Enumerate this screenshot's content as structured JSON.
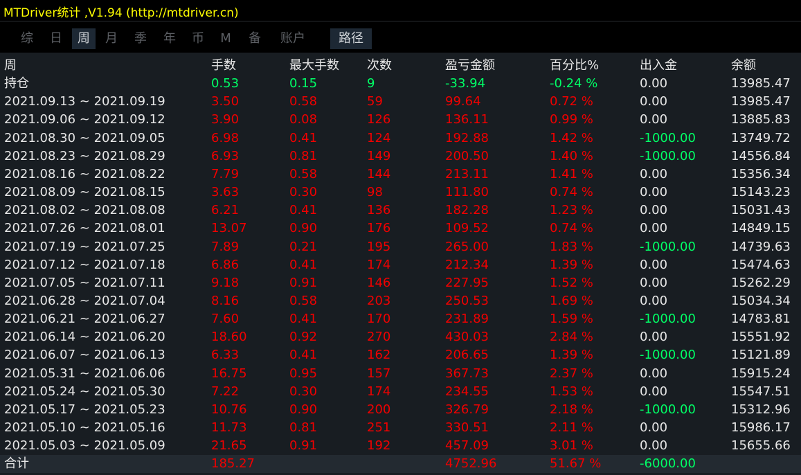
{
  "window": {
    "title": "MTDriver统计 ,V1.94 (http://mtdriver.cn)"
  },
  "colors": {
    "title": "#ffff00",
    "background": "#181d22",
    "text": "#e6e6e6",
    "loss": "#00ff66",
    "profit": "#f00000",
    "tab_inactive": "#5c5f64",
    "tab_active_bg": "#1d2834"
  },
  "tabs": [
    {
      "label": "综",
      "active": false
    },
    {
      "label": "日",
      "active": false
    },
    {
      "label": "周",
      "active": true
    },
    {
      "label": "月",
      "active": false
    },
    {
      "label": "季",
      "active": false
    },
    {
      "label": "年",
      "active": false
    },
    {
      "label": "币",
      "active": false
    },
    {
      "label": "M",
      "active": false
    },
    {
      "label": "备",
      "active": false
    },
    {
      "label": "账户",
      "active": false
    },
    {
      "label": "路径",
      "active": true
    }
  ],
  "columns": [
    "周",
    "手数",
    "最大手数",
    "次数",
    "盈亏金额",
    "百分比%",
    "出入金",
    "余额"
  ],
  "position_row": {
    "label": "持仓",
    "lots": "0.53",
    "max_lots": "0.15",
    "count": "9",
    "pnl": "-33.94",
    "pct": "-0.24 %",
    "flow": "0.00",
    "balance": "13985.47"
  },
  "rows": [
    {
      "week": "2021.09.13 ~ 2021.09.19",
      "lots": "3.50",
      "max_lots": "0.58",
      "count": "59",
      "pnl": "99.64",
      "pct": "0.72 %",
      "flow": "0.00",
      "balance": "13985.47"
    },
    {
      "week": "2021.09.06 ~ 2021.09.12",
      "lots": "3.90",
      "max_lots": "0.08",
      "count": "126",
      "pnl": "136.11",
      "pct": "0.99 %",
      "flow": "0.00",
      "balance": "13885.83"
    },
    {
      "week": "2021.08.30 ~ 2021.09.05",
      "lots": "6.98",
      "max_lots": "0.41",
      "count": "124",
      "pnl": "192.88",
      "pct": "1.42 %",
      "flow": "-1000.00",
      "balance": "13749.72"
    },
    {
      "week": "2021.08.23 ~ 2021.08.29",
      "lots": "6.93",
      "max_lots": "0.81",
      "count": "149",
      "pnl": "200.50",
      "pct": "1.40 %",
      "flow": "-1000.00",
      "balance": "14556.84"
    },
    {
      "week": "2021.08.16 ~ 2021.08.22",
      "lots": "7.79",
      "max_lots": "0.58",
      "count": "144",
      "pnl": "213.11",
      "pct": "1.41 %",
      "flow": "0.00",
      "balance": "15356.34"
    },
    {
      "week": "2021.08.09 ~ 2021.08.15",
      "lots": "3.63",
      "max_lots": "0.30",
      "count": "98",
      "pnl": "111.80",
      "pct": "0.74 %",
      "flow": "0.00",
      "balance": "15143.23"
    },
    {
      "week": "2021.08.02 ~ 2021.08.08",
      "lots": "6.21",
      "max_lots": "0.41",
      "count": "136",
      "pnl": "182.28",
      "pct": "1.23 %",
      "flow": "0.00",
      "balance": "15031.43"
    },
    {
      "week": "2021.07.26 ~ 2021.08.01",
      "lots": "13.07",
      "max_lots": "0.90",
      "count": "176",
      "pnl": "109.52",
      "pct": "0.74 %",
      "flow": "0.00",
      "balance": "14849.15"
    },
    {
      "week": "2021.07.19 ~ 2021.07.25",
      "lots": "7.89",
      "max_lots": "0.21",
      "count": "195",
      "pnl": "265.00",
      "pct": "1.83 %",
      "flow": "-1000.00",
      "balance": "14739.63"
    },
    {
      "week": "2021.07.12 ~ 2021.07.18",
      "lots": "6.86",
      "max_lots": "0.41",
      "count": "174",
      "pnl": "212.34",
      "pct": "1.39 %",
      "flow": "0.00",
      "balance": "15474.63"
    },
    {
      "week": "2021.07.05 ~ 2021.07.11",
      "lots": "9.18",
      "max_lots": "0.91",
      "count": "146",
      "pnl": "227.95",
      "pct": "1.52 %",
      "flow": "0.00",
      "balance": "15262.29"
    },
    {
      "week": "2021.06.28 ~ 2021.07.04",
      "lots": "8.16",
      "max_lots": "0.58",
      "count": "203",
      "pnl": "250.53",
      "pct": "1.69 %",
      "flow": "0.00",
      "balance": "15034.34"
    },
    {
      "week": "2021.06.21 ~ 2021.06.27",
      "lots": "7.60",
      "max_lots": "0.41",
      "count": "170",
      "pnl": "231.89",
      "pct": "1.59 %",
      "flow": "-1000.00",
      "balance": "14783.81"
    },
    {
      "week": "2021.06.14 ~ 2021.06.20",
      "lots": "18.60",
      "max_lots": "0.92",
      "count": "270",
      "pnl": "430.03",
      "pct": "2.84 %",
      "flow": "0.00",
      "balance": "15551.92"
    },
    {
      "week": "2021.06.07 ~ 2021.06.13",
      "lots": "6.33",
      "max_lots": "0.41",
      "count": "162",
      "pnl": "206.65",
      "pct": "1.39 %",
      "flow": "-1000.00",
      "balance": "15121.89"
    },
    {
      "week": "2021.05.31 ~ 2021.06.06",
      "lots": "16.75",
      "max_lots": "0.95",
      "count": "157",
      "pnl": "367.73",
      "pct": "2.37 %",
      "flow": "0.00",
      "balance": "15915.24"
    },
    {
      "week": "2021.05.24 ~ 2021.05.30",
      "lots": "7.22",
      "max_lots": "0.30",
      "count": "174",
      "pnl": "234.55",
      "pct": "1.53 %",
      "flow": "0.00",
      "balance": "15547.51"
    },
    {
      "week": "2021.05.17 ~ 2021.05.23",
      "lots": "10.76",
      "max_lots": "0.90",
      "count": "200",
      "pnl": "326.79",
      "pct": "2.18 %",
      "flow": "-1000.00",
      "balance": "15312.96"
    },
    {
      "week": "2021.05.10 ~ 2021.05.16",
      "lots": "11.73",
      "max_lots": "0.81",
      "count": "251",
      "pnl": "330.51",
      "pct": "2.11 %",
      "flow": "0.00",
      "balance": "15986.17"
    },
    {
      "week": "2021.05.03 ~ 2021.05.09",
      "lots": "21.65",
      "max_lots": "0.91",
      "count": "192",
      "pnl": "457.09",
      "pct": "3.01 %",
      "flow": "0.00",
      "balance": "15655.66"
    }
  ],
  "total_row": {
    "label": "合计",
    "lots": "185.27",
    "pnl": "4752.96",
    "pct": "51.67 %",
    "flow": "-6000.00"
  }
}
